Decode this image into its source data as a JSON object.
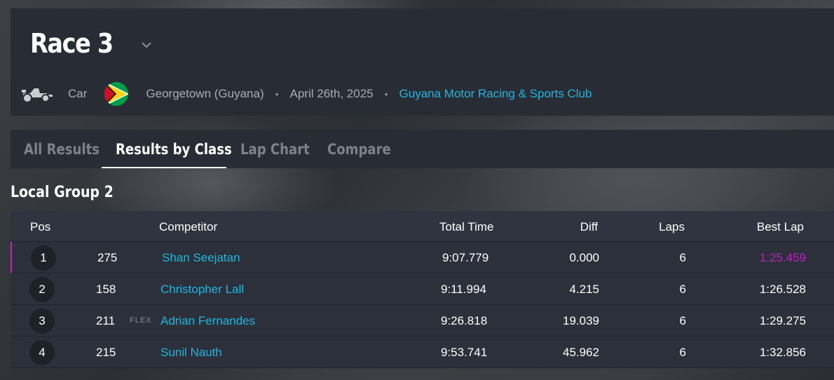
{
  "header": {
    "title": "Race 3",
    "vehicle": "Car",
    "location": "Georgetown (Guyana)",
    "separator": "•",
    "date": "April 26th, 2025",
    "club": "Guyana Motor Racing & Sports Club"
  },
  "tabs": [
    {
      "label": "All Results",
      "active": false
    },
    {
      "label": "Results by Class",
      "active": true
    },
    {
      "label": "Lap Chart",
      "active": false
    },
    {
      "label": "Compare",
      "active": false
    }
  ],
  "group": {
    "title": "Local Group 2"
  },
  "table": {
    "headers": {
      "pos": "Pos",
      "competitor": "Competitor",
      "total_time": "Total Time",
      "diff": "Diff",
      "laps": "Laps",
      "best_lap": "Best Lap"
    },
    "rows": [
      {
        "pos": "1",
        "number": "275",
        "badge": "",
        "competitor": "Shan Seejatan",
        "total_time": "9:07.779",
        "diff": "0.000",
        "laps": "6",
        "best_lap": "1:25.459",
        "best_overall": true
      },
      {
        "pos": "2",
        "number": "158",
        "badge": "",
        "competitor": "Christopher Lall",
        "total_time": "9:11.994",
        "diff": "4.215",
        "laps": "6",
        "best_lap": "1:26.528",
        "best_overall": false
      },
      {
        "pos": "3",
        "number": "211",
        "badge": "FLEX",
        "competitor": "Adrian Fernandes",
        "total_time": "9:26.818",
        "diff": "19.039",
        "laps": "6",
        "best_lap": "1:29.275",
        "best_overall": false
      },
      {
        "pos": "4",
        "number": "215",
        "badge": "",
        "competitor": "Sunil Nauth",
        "total_time": "9:53.741",
        "diff": "45.962",
        "laps": "6",
        "best_lap": "1:32.856",
        "best_overall": false
      }
    ]
  },
  "colors": {
    "accent": "#1fb6e0",
    "best_lap": "#c61fc6",
    "panel": "#282d35"
  },
  "icons": {
    "vehicle": "race-car-icon",
    "flag": "guyana-flag-icon",
    "dropdown": "chevron-down-icon"
  }
}
